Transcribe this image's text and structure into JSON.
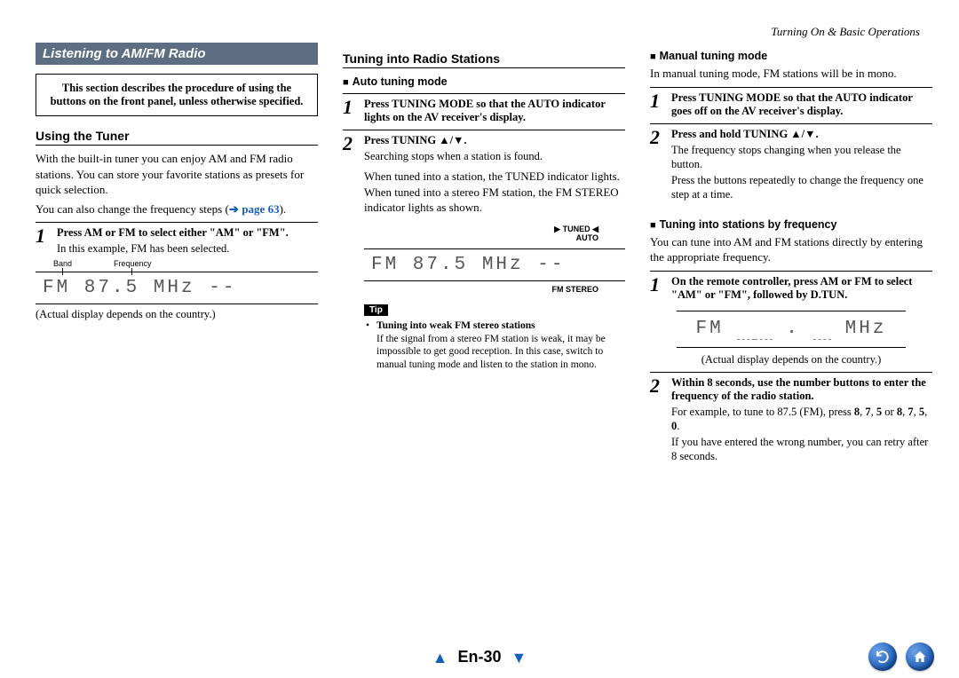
{
  "header": {
    "section": "Turning On & Basic Operations"
  },
  "banner": "Listening to AM/FM Radio",
  "intro_box": "This section describes the procedure of using the buttons on the front panel, unless otherwise specified.",
  "col1": {
    "h_using": "Using the Tuner",
    "p1": "With the built-in tuner you can enjoy AM and FM radio stations. You can store your favorite stations as presets for quick selection.",
    "p2a": "You can also change the frequency steps (",
    "p2_xref": "page 63",
    "p2b": ").",
    "step1_title": "Press AM or FM to select either \"AM\" or \"FM\".",
    "step1_text": "In this example, FM has been selected.",
    "label_band": "Band",
    "label_freq": "Frequency",
    "display1": "FM 87.5 MHz --",
    "caption1": "(Actual display depends on the country.)"
  },
  "col2": {
    "h_tuning": "Tuning into Radio Stations",
    "sub_auto": "Auto tuning mode",
    "step1_title": "Press TUNING MODE so that the AUTO indicator lights on the AV receiver's display.",
    "step2_title": "Press TUNING ▲/▼.",
    "step2_text": "Searching stops when a station is found.",
    "p_tuned": "When tuned into a station, the TUNED indicator lights. When tuned into a stereo FM station, the FM STEREO indicator lights as shown.",
    "lbl_tuned": "TUNED",
    "lbl_auto": "AUTO",
    "display2": "FM 87.5 MHz --",
    "lbl_fmstereo": "FM STEREO",
    "tip_label": "Tip",
    "tip_head": "Tuning into weak FM stereo stations",
    "tip_body": "If the signal from a stereo FM station is weak, it may be impossible to get good reception. In this case, switch to manual tuning mode and listen to the station in mono."
  },
  "col3": {
    "sub_manual": "Manual tuning mode",
    "p_manual": "In manual tuning mode, FM stations will be in mono.",
    "m_step1_title": "Press TUNING MODE so that the AUTO indicator goes off on the AV receiver's display.",
    "m_step2_title": "Press and hold TUNING ▲/▼.",
    "m_step2_text1": "The frequency stops changing when you release the button.",
    "m_step2_text2": "Press the buttons repeatedly to change the frequency one step at a time.",
    "sub_byfreq": "Tuning into stations by frequency",
    "p_byfreq": "You can tune into AM and FM stations directly by entering the appropriate frequency.",
    "f_step1_title": "On the remote controller, press AM or FM to select \"AM\" or \"FM\", followed by D.TUN.",
    "disp3_a": "FM",
    "disp3_b": "_",
    "disp3_c": "_ . _",
    "disp3_d": "MHz",
    "caption3": "(Actual display depends on the country.)",
    "f_step2_title": "Within 8 seconds, use the number buttons to enter the frequency of the radio station.",
    "f_step2_text1": "For example, to tune to 87.5 (FM), press 8, 7, 5 or 8, 7, 5, 0.",
    "f_step2_text2": "If you have entered the wrong number, you can retry after 8 seconds."
  },
  "footer": {
    "page": "En-30"
  }
}
